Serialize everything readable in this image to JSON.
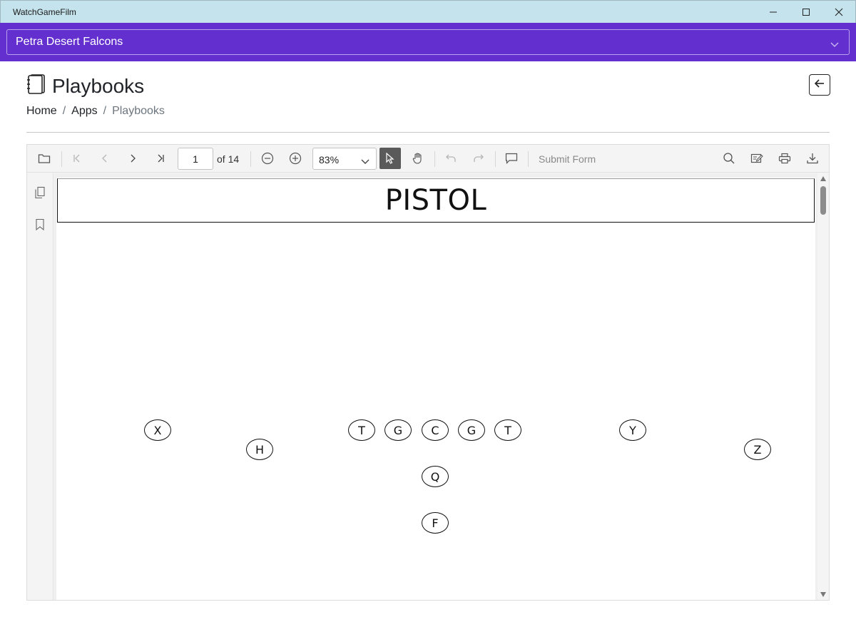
{
  "window": {
    "title": "WatchGameFilm",
    "controls": [
      "minimize-icon",
      "maximize-icon",
      "close-icon"
    ]
  },
  "team_selector": {
    "selected": "Petra Desert Falcons",
    "accent": "#6330cf"
  },
  "header": {
    "title": "Playbooks",
    "icon": "notebook-icon",
    "back_icon": "arrow-back-icon"
  },
  "breadcrumb": {
    "items": [
      "Home",
      "Apps"
    ],
    "separator": "/",
    "current": "Playbooks"
  },
  "viewer": {
    "toolbar": {
      "open_icon": "folder-open-icon",
      "first_icon": "first-page-icon",
      "prev_icon": "prev-page-icon",
      "next_icon": "next-page-icon",
      "last_icon": "last-page-icon",
      "current_page": "1",
      "page_total_label": "of 14",
      "zoom_out_icon": "zoom-out-icon",
      "zoom_in_icon": "zoom-in-icon",
      "zoom_value": "83%",
      "select_tool_icon": "cursor-icon",
      "pan_tool_icon": "hand-icon",
      "undo_icon": "undo-icon",
      "redo_icon": "redo-icon",
      "comment_icon": "comment-icon",
      "submit_form_label": "Submit Form",
      "search_icon": "search-icon",
      "annotate_icon": "annotate-icon",
      "print_icon": "print-icon",
      "download_icon": "download-icon"
    },
    "side_panel": {
      "thumbnails_icon": "page-thumbnails-icon",
      "bookmarks_icon": "bookmark-icon"
    },
    "document": {
      "play_name": "PISTOL",
      "players": [
        "X",
        "H",
        "T",
        "G",
        "C",
        "G",
        "T",
        "Y",
        "Z",
        "Q",
        "F"
      ]
    }
  }
}
